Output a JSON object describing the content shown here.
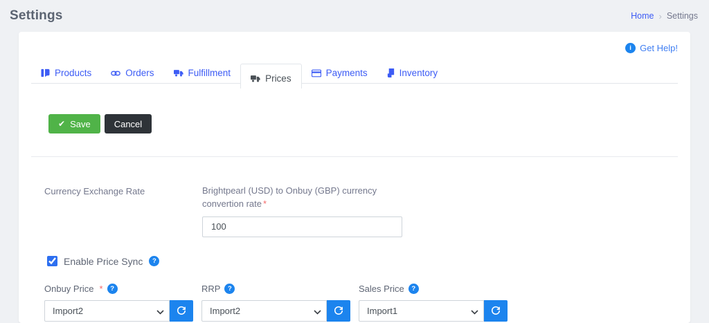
{
  "page": {
    "title": "Settings"
  },
  "breadcrumb": {
    "home": "Home",
    "separator": "›",
    "current": "Settings"
  },
  "help_link": {
    "label": "Get Help!",
    "icon": "info-icon"
  },
  "tabs": {
    "0": {
      "label": "Products",
      "icon": "products-icon",
      "active": false
    },
    "1": {
      "label": "Orders",
      "icon": "orders-icon",
      "active": false
    },
    "2": {
      "label": "Fulfillment",
      "icon": "fulfillment-truck-icon",
      "active": false
    },
    "3": {
      "label": "Prices",
      "icon": "prices-truck-icon",
      "active": true
    },
    "4": {
      "label": "Payments",
      "icon": "payments-card-icon",
      "active": false
    },
    "5": {
      "label": "Inventory",
      "icon": "inventory-bookmark-icon",
      "active": false
    }
  },
  "toolbar": {
    "save_label": "Save",
    "cancel_label": "Cancel",
    "save_color": "#50b348",
    "cancel_color": "#2e3338"
  },
  "currency_section": {
    "label": "Currency Exchange Rate",
    "field_label": "Brightpearl (USD) to Onbuy (GBP) currency convertion rate",
    "required_marker": "*",
    "value": "100"
  },
  "price_sync": {
    "label": "Enable Price Sync",
    "checked": true,
    "help_icon": "question-icon"
  },
  "price_fields": {
    "0": {
      "label": "Onbuy Price",
      "required_marker": "*",
      "value": "Import2"
    },
    "1": {
      "label": "RRP",
      "required_marker": "",
      "value": "Import2"
    },
    "2": {
      "label": "Sales Price",
      "required_marker": "",
      "value": "Import1"
    }
  },
  "colors": {
    "accent_blue": "#3d5cf5",
    "action_blue": "#1c84ee",
    "save_green": "#50b348",
    "cancel_dark": "#2e3338",
    "required_red": "#f46a6a",
    "page_bg": "#eff1f4"
  }
}
